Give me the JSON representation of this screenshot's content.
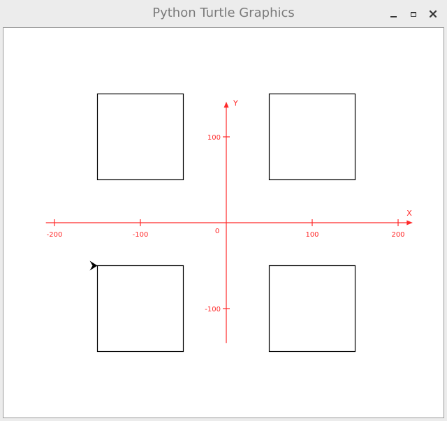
{
  "window": {
    "title": "Python Turtle Graphics",
    "controls": {
      "minimize": "minimize-icon",
      "maximize": "maximize-icon",
      "close": "close-icon"
    }
  },
  "axes": {
    "color": "#ff2a2a",
    "x_label": "X",
    "y_label": "Y",
    "origin_label": "0",
    "x_ticks": [
      {
        "value": -200,
        "label": "-200"
      },
      {
        "value": -100,
        "label": "-100"
      },
      {
        "value": 100,
        "label": "100"
      },
      {
        "value": 200,
        "label": "200"
      }
    ],
    "y_ticks": [
      {
        "value": 100,
        "label": "100"
      },
      {
        "value": -100,
        "label": "-100"
      }
    ]
  },
  "squares": [
    {
      "name": "square-top-left",
      "x": -150,
      "y": 150,
      "size": 100
    },
    {
      "name": "square-top-right",
      "x": 50,
      "y": 150,
      "size": 100
    },
    {
      "name": "square-bottom-left",
      "x": -150,
      "y": -50,
      "size": 100
    },
    {
      "name": "square-bottom-right",
      "x": 50,
      "y": -50,
      "size": 100
    }
  ],
  "turtle": {
    "x": -150,
    "y": -50,
    "heading": 0,
    "color": "#000000"
  }
}
